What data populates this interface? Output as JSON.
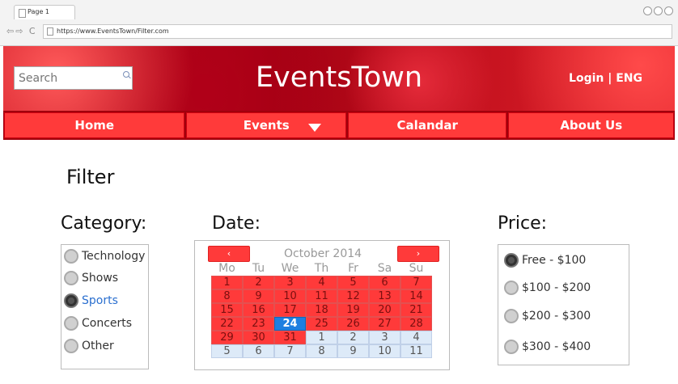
{
  "browser": {
    "tab_title": "Page 1",
    "url": "https://www.EventsTown/Filter.com",
    "nav_arrows": "⇦⇨ C"
  },
  "header": {
    "search_placeholder": "Search",
    "site_title": "EventsTown",
    "login": "Login | ENG"
  },
  "nav": {
    "home": "Home",
    "events": "Events",
    "calendar": "Calandar",
    "about": "About Us"
  },
  "filter": {
    "title": "Filter",
    "category": {
      "label": "Category:",
      "options": [
        "Technology",
        "Shows",
        "Sports",
        "Concerts",
        "Other"
      ],
      "selected": "Sports"
    },
    "date": {
      "label": "Date:",
      "prev": "‹",
      "next": "›",
      "month": "October 2014",
      "weekdays": [
        "Mo",
        "Tu",
        "We",
        "Th",
        "Fr",
        "Sa",
        "Su"
      ],
      "weeks": [
        [
          "1",
          "2",
          "3",
          "4",
          "5",
          "6",
          "7"
        ],
        [
          "8",
          "9",
          "10",
          "11",
          "12",
          "13",
          "14"
        ],
        [
          "15",
          "16",
          "17",
          "18",
          "19",
          "20",
          "21"
        ],
        [
          "22",
          "23",
          "24",
          "25",
          "26",
          "27",
          "28"
        ],
        [
          "29",
          "30",
          "31",
          "1",
          "2",
          "3",
          "4"
        ],
        [
          "5",
          "6",
          "7",
          "8",
          "9",
          "10",
          "11"
        ]
      ],
      "selected_day": "24"
    },
    "price": {
      "label": "Price:",
      "options": [
        "Free - $100",
        "$100 - $200",
        "$200 - $300",
        "$300 - $400"
      ],
      "selected": "Free - $100"
    }
  },
  "colors": {
    "accent": "#ff3a3a",
    "banner": "#b0001a",
    "selected": "#1e7fe0",
    "link": "#2a6fcf"
  }
}
